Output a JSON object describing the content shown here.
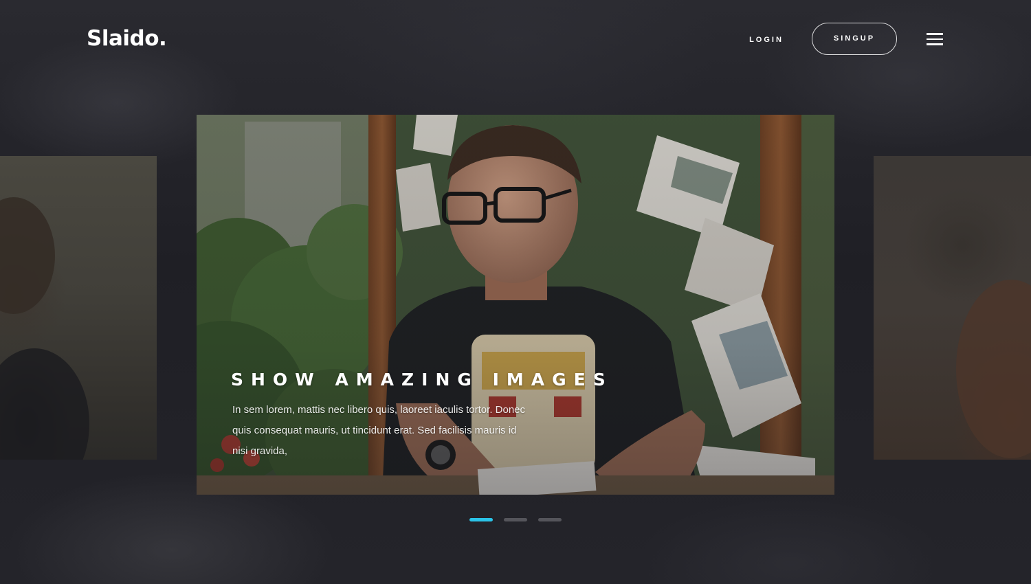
{
  "header": {
    "logo": "Slaido.",
    "login_label": "LOGIN",
    "signup_label": "SINGUP",
    "menu_icon": "hamburger-menu-icon"
  },
  "slider": {
    "active_index": 0,
    "slides": [
      {
        "title": "SHOW AMAZING IMAGES",
        "text": "In sem lorem, mattis nec libero quis, laoreet iaculis tortor. Donec quis consequat mauris, ut tincidunt erat. Sed facilisis mauris id nisi gravida,"
      }
    ],
    "dot_count": 3
  },
  "colors": {
    "accent": "#2bc4e8",
    "inactive_dot": "#55555b",
    "background": "#1f1f25"
  }
}
